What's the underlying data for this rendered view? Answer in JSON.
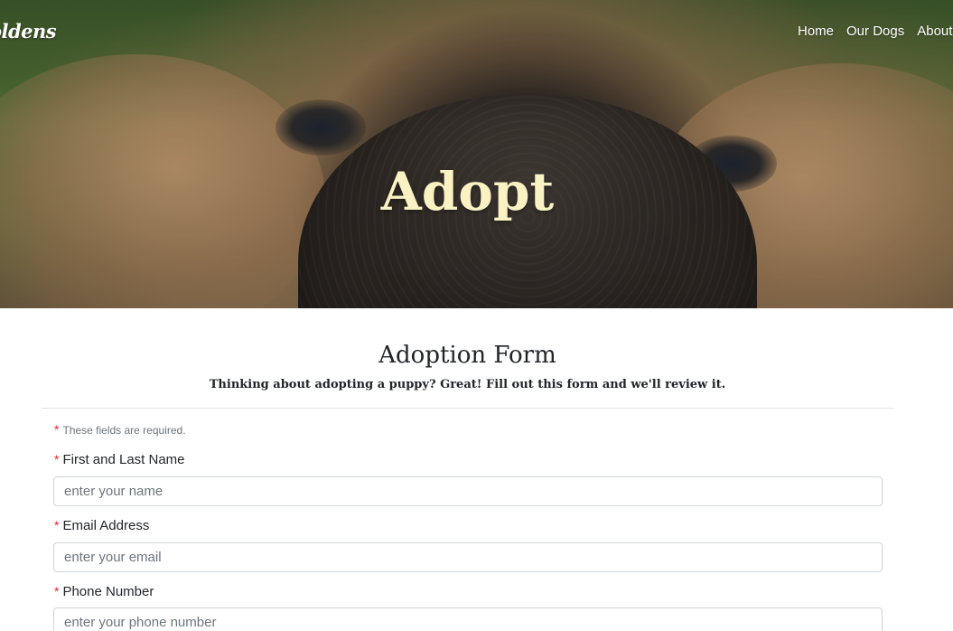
{
  "brand": {
    "name": "oldens"
  },
  "nav": {
    "items": [
      "Home",
      "Our Dogs",
      "About"
    ]
  },
  "hero": {
    "title": "Adopt"
  },
  "form": {
    "title": "Adoption Form",
    "subtitle": "Thinking about adopting a puppy? Great! Fill out this form and we'll review it.",
    "required_note": "These fields are required.",
    "required_marker": "*",
    "fields": [
      {
        "label": "First and Last Name",
        "placeholder": "enter your name",
        "value": ""
      },
      {
        "label": "Email Address",
        "placeholder": "enter your email",
        "value": ""
      },
      {
        "label": "Phone Number",
        "placeholder": "enter your phone number",
        "value": ""
      }
    ]
  },
  "colors": {
    "hero_title": "#fbf2c4",
    "required_star": "#e3262a",
    "text": "#212529",
    "input_border": "#ced4da"
  }
}
